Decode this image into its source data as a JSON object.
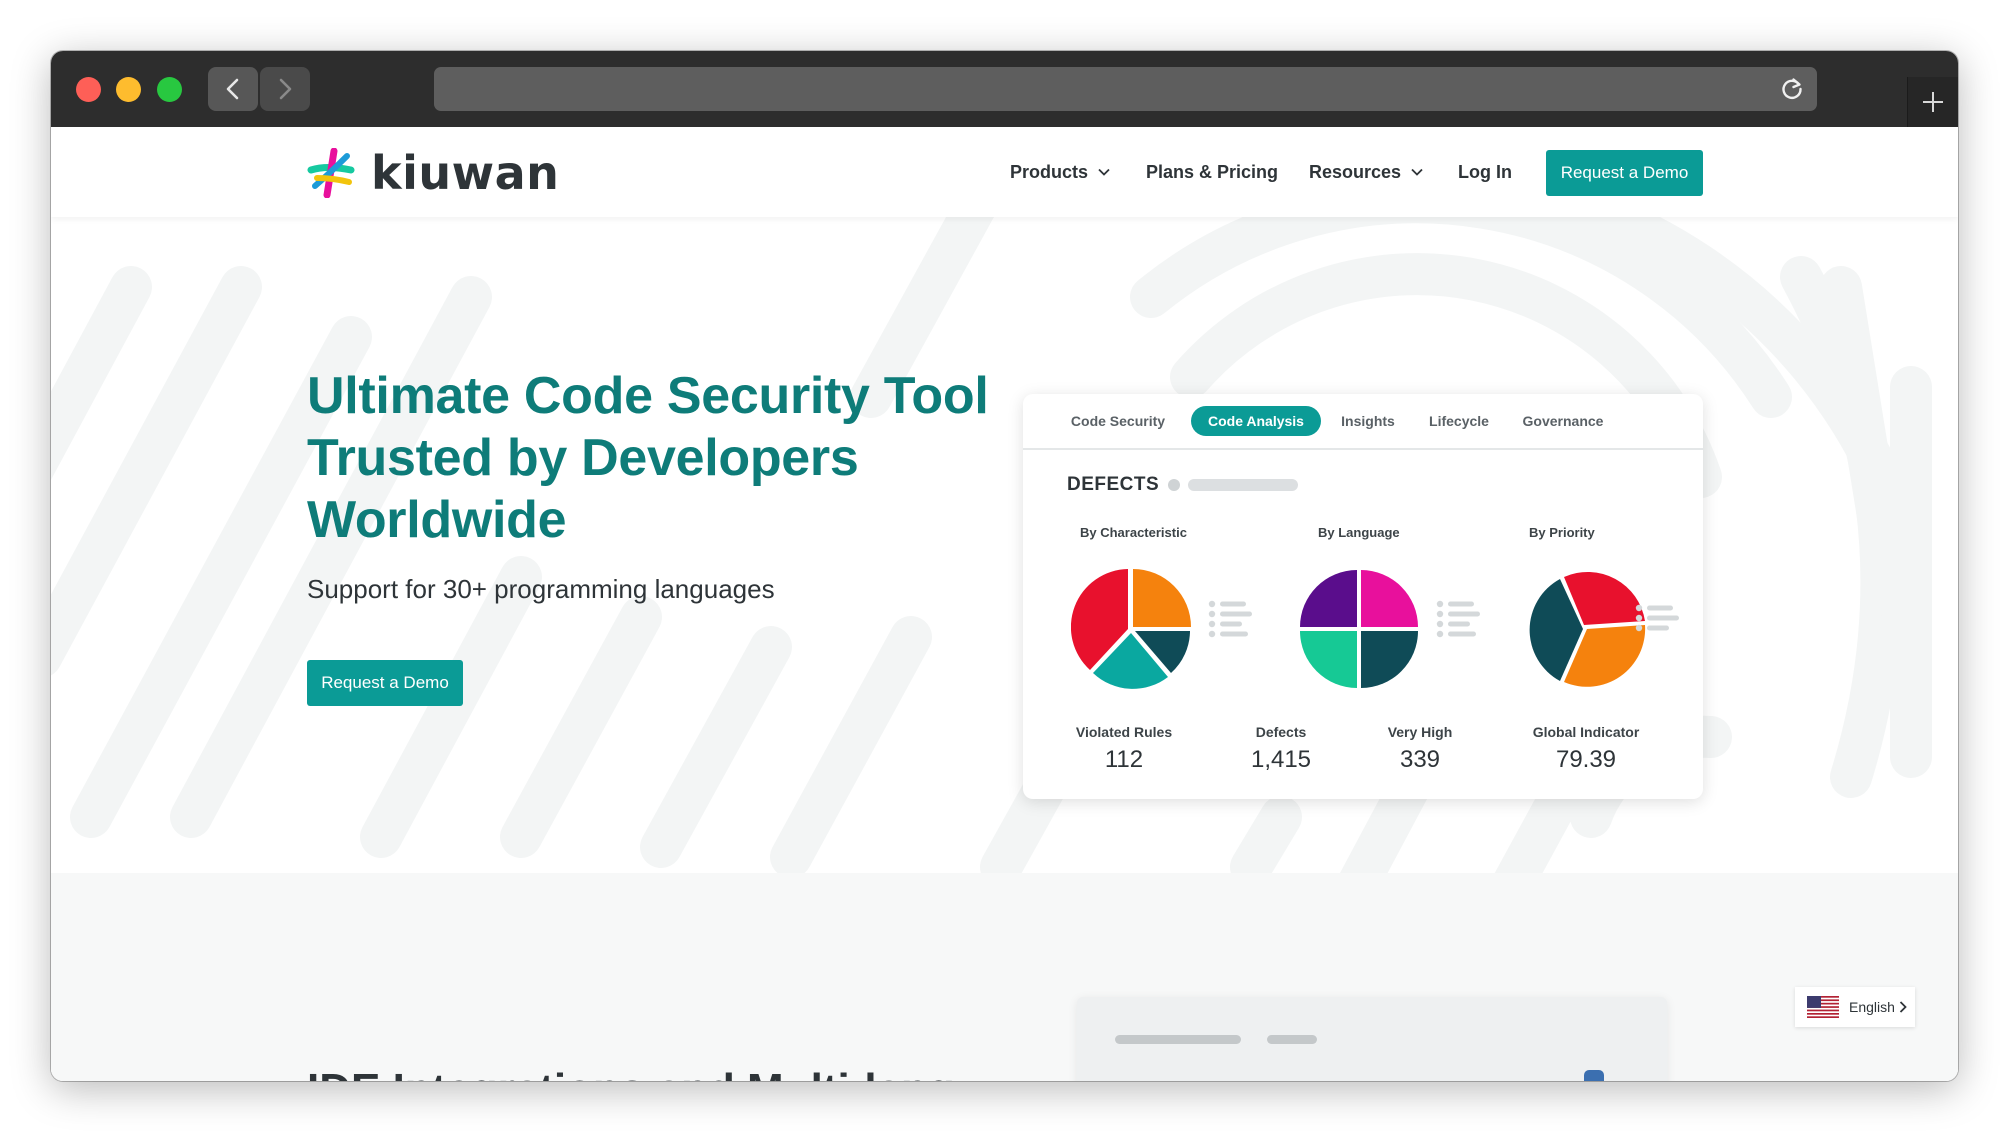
{
  "site": {
    "logo_text": "kiuwan",
    "brand_color": "#0b9b96",
    "heading_color": "#0e7c79"
  },
  "nav": {
    "products": "Products",
    "plans": "Plans & Pricing",
    "resources": "Resources",
    "login": "Log In",
    "demo": "Request a Demo"
  },
  "hero": {
    "headline": "Ultimate Code Security Tool Trusted by Developers Worldwide",
    "subhead": "Support for 30+ programming languages",
    "cta": "Request a Demo"
  },
  "dashboard": {
    "tabs": [
      {
        "label": "Code Security",
        "active": false
      },
      {
        "label": "Code Analysis",
        "active": true
      },
      {
        "label": "Insights",
        "active": false
      },
      {
        "label": "Lifecycle",
        "active": false
      },
      {
        "label": "Governance",
        "active": false
      }
    ],
    "title": "DEFECTS",
    "pies": [
      {
        "label": "By Characteristic",
        "colors": [
          "#f5820d",
          "#0f4b57",
          "#0aa8a0",
          "#e8112d"
        ]
      },
      {
        "label": "By Language",
        "colors": [
          "#e8109c",
          "#0f4b57",
          "#16c995",
          "#5a0d8c"
        ]
      },
      {
        "label": "By Priority",
        "colors": [
          "#e8112d",
          "#f5820d",
          "#0f4b57"
        ]
      }
    ],
    "metrics": [
      {
        "label": "Violated Rules",
        "value": "112"
      },
      {
        "label": "Defects",
        "value": "1,415"
      },
      {
        "label": "Very High",
        "value": "339"
      },
      {
        "label": "Global Indicator",
        "value": "79.39"
      }
    ]
  },
  "section2": {
    "title": "IDE Integrations and Multi-lang"
  },
  "language_selector": {
    "label": "English",
    "flag_icon": "us-flag-icon"
  }
}
